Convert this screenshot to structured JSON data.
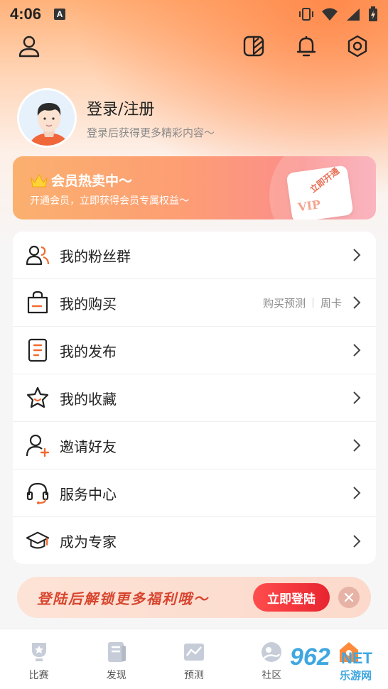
{
  "status_bar": {
    "time": "4:06",
    "badge": "A"
  },
  "header": {
    "user_icon": "user-icon",
    "skin_icon": "theme-icon",
    "bell_icon": "bell-icon",
    "settings_icon": "settings-icon"
  },
  "profile": {
    "title": "登录/注册",
    "subtitle": "登录后获得更多精彩内容～"
  },
  "vip_banner": {
    "title": "会员热卖中～",
    "subtitle": "开通会员，立即获得会员专属权益～",
    "cube_text": "VIP",
    "cube_label": "立即开通"
  },
  "menu": {
    "items": [
      {
        "label": "我的粉丝群",
        "icon": "fans-group-icon"
      },
      {
        "label": "我的购买",
        "icon": "shopping-bag-icon",
        "extra_1": "购买预测",
        "extra_2": "周卡"
      },
      {
        "label": "我的发布",
        "icon": "document-icon"
      },
      {
        "label": "我的收藏",
        "icon": "star-icon"
      },
      {
        "label": "邀请好友",
        "icon": "invite-friend-icon"
      },
      {
        "label": "服务中心",
        "icon": "headset-icon"
      },
      {
        "label": "成为专家",
        "icon": "graduation-cap-icon"
      }
    ]
  },
  "promo": {
    "text": "登陆后解锁更多福利哦～",
    "button": "立即登陆"
  },
  "tabbar": {
    "items": [
      {
        "label": "比赛",
        "icon": "trophy-icon"
      },
      {
        "label": "发现",
        "icon": "discover-icon"
      },
      {
        "label": "预测",
        "icon": "prediction-icon"
      },
      {
        "label": "社区",
        "icon": "community-icon"
      },
      {
        "label": "",
        "icon": "home-mine-icon"
      }
    ]
  },
  "watermark": {
    "num": "962",
    "net": "NET",
    "cn": "乐游网"
  },
  "colors": {
    "accent": "#ff7a3d",
    "promo_red": "#e8242f",
    "watermark": "#3fa7e0"
  }
}
